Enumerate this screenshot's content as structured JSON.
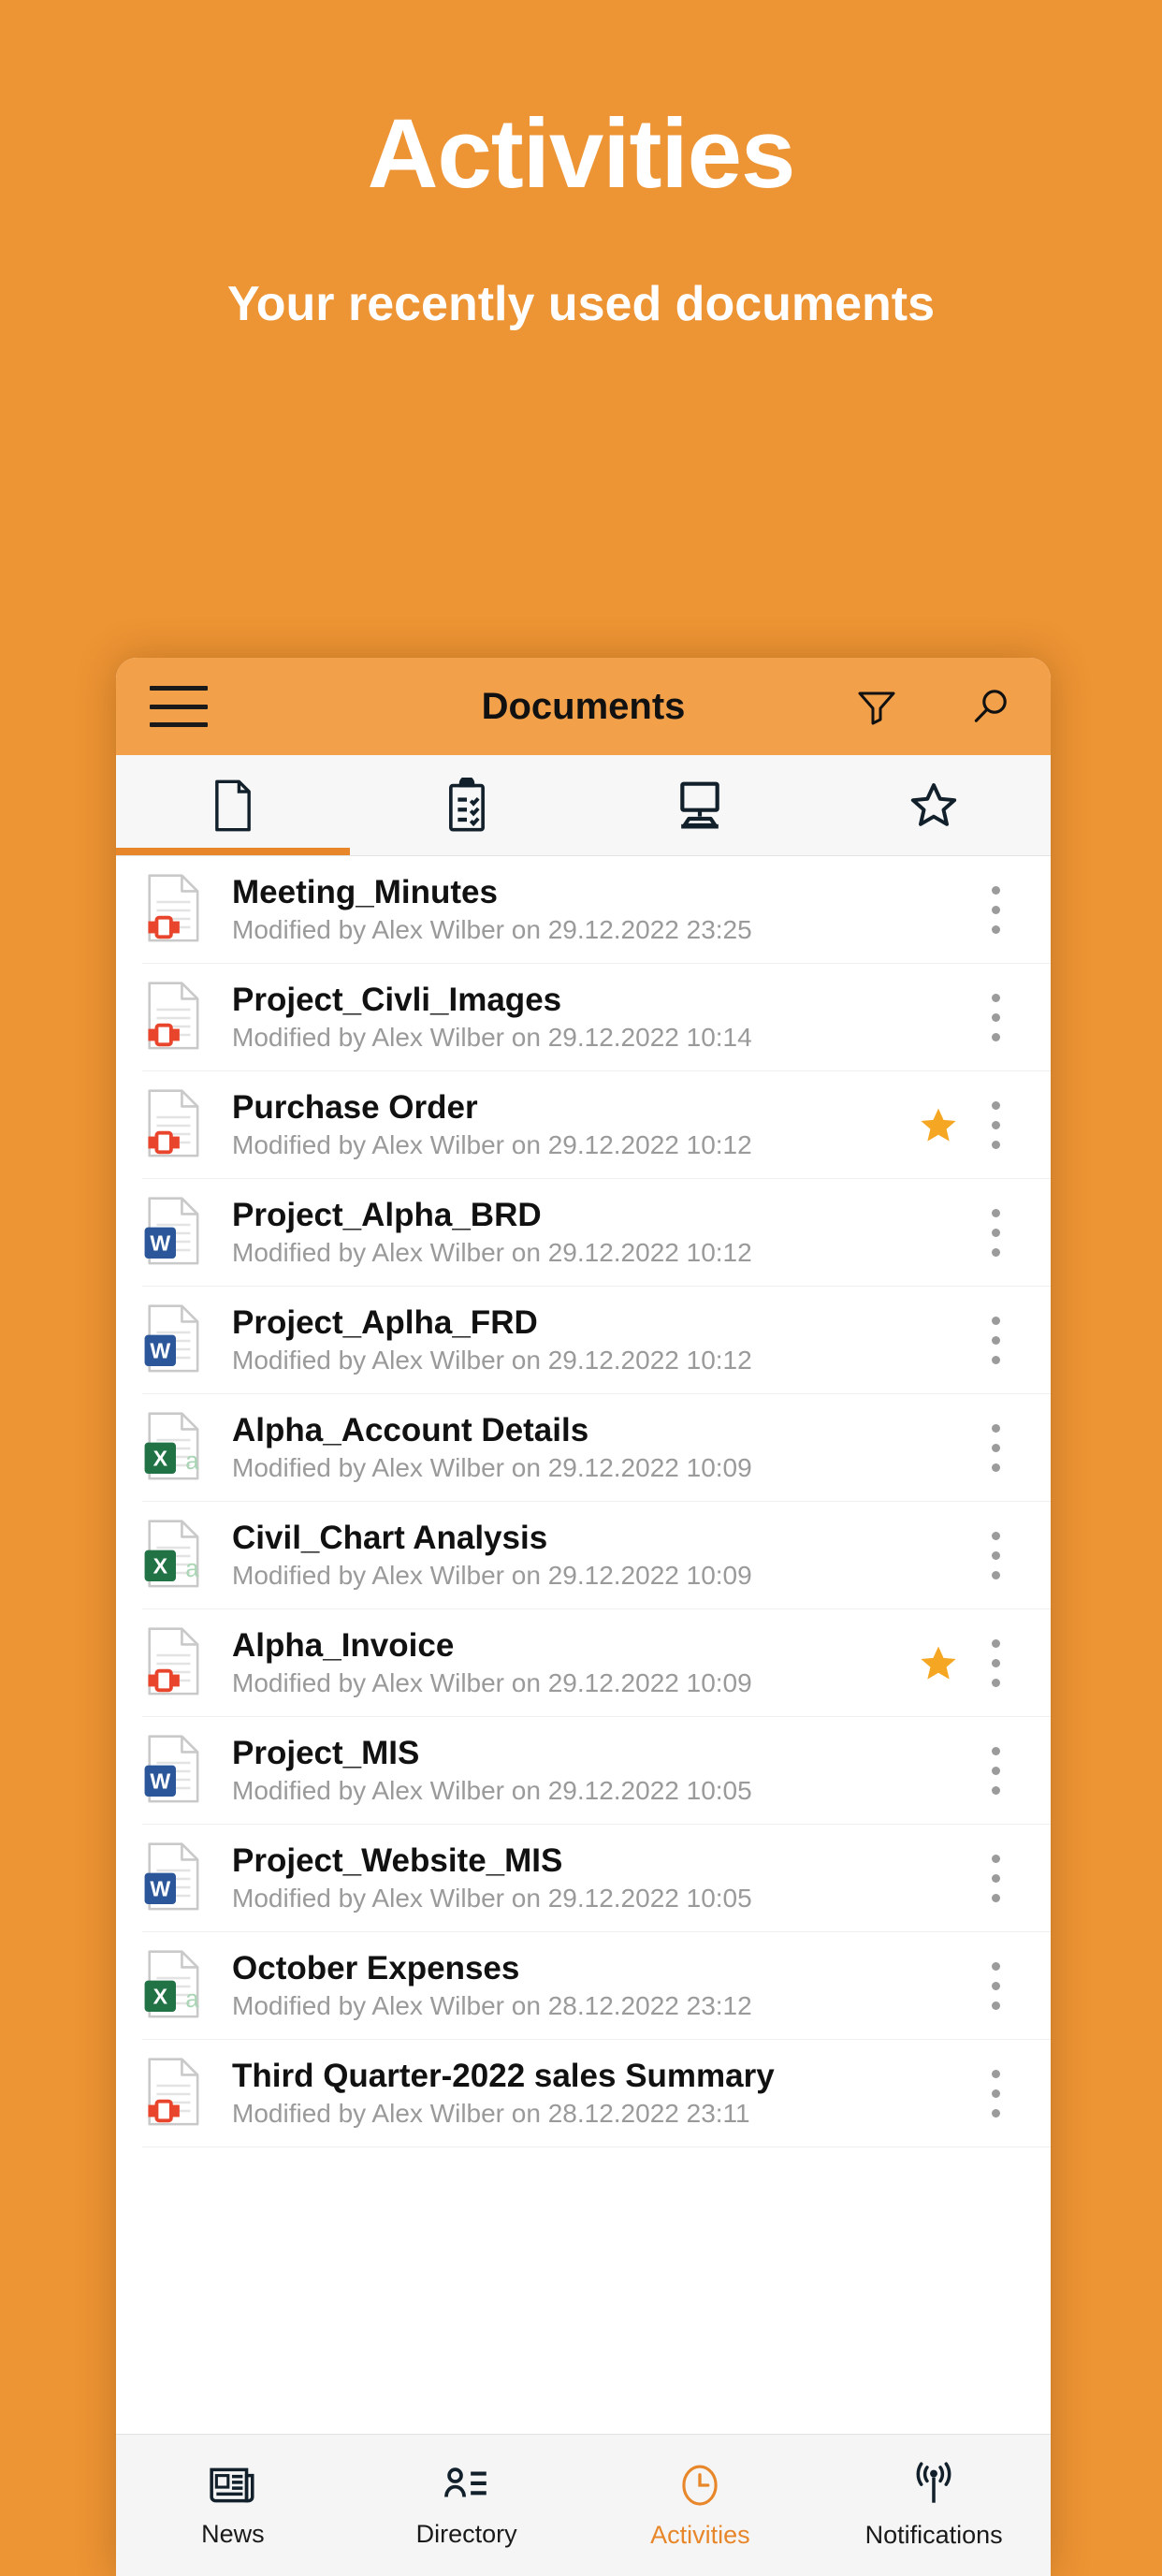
{
  "promo": {
    "title": "Activities",
    "subtitle": "Your recently used documents"
  },
  "colors": {
    "background": "#ED9434",
    "appbar": "#F2A14A",
    "accent": "#E8862A",
    "star": "#F5A623",
    "word": "#2B579A",
    "excel": "#217346",
    "pdf": "#E8452C"
  },
  "appbar": {
    "title": "Documents",
    "menu_icon": "hamburger-menu-icon",
    "filter_icon": "filter-funnel-icon",
    "search_icon": "search-magnifier-icon"
  },
  "tabs": [
    {
      "name": "documents",
      "icon": "document-page-icon",
      "active": true
    },
    {
      "name": "tasks",
      "icon": "clipboard-checklist-icon",
      "active": false
    },
    {
      "name": "sites",
      "icon": "desktop-monitor-icon",
      "active": false
    },
    {
      "name": "favorites",
      "icon": "star-outline-icon",
      "active": false
    }
  ],
  "documents": [
    {
      "name": "Meeting_Minutes",
      "meta": "Modified by Alex Wilber on 29.12.2022 23:25",
      "type": "pdf",
      "starred": false
    },
    {
      "name": "Project_Civli_Images",
      "meta": "Modified by Alex Wilber on 29.12.2022 10:14",
      "type": "pdf",
      "starred": false
    },
    {
      "name": "Purchase Order",
      "meta": "Modified by Alex Wilber on 29.12.2022 10:12",
      "type": "pdf",
      "starred": true
    },
    {
      "name": "Project_Alpha_BRD",
      "meta": "Modified by Alex Wilber on 29.12.2022 10:12",
      "type": "word",
      "starred": false
    },
    {
      "name": "Project_Aplha_FRD",
      "meta": "Modified by Alex Wilber on 29.12.2022 10:12",
      "type": "word",
      "starred": false
    },
    {
      "name": "Alpha_Account Details",
      "meta": "Modified by Alex Wilber on 29.12.2022 10:09",
      "type": "excel",
      "starred": false
    },
    {
      "name": "Civil_Chart Analysis",
      "meta": "Modified by Alex Wilber on 29.12.2022 10:09",
      "type": "excel",
      "starred": false
    },
    {
      "name": "Alpha_Invoice",
      "meta": "Modified by Alex Wilber on 29.12.2022 10:09",
      "type": "pdf",
      "starred": true
    },
    {
      "name": "Project_MIS",
      "meta": "Modified by Alex Wilber on 29.12.2022 10:05",
      "type": "word",
      "starred": false
    },
    {
      "name": "Project_Website_MIS",
      "meta": "Modified by Alex Wilber on 29.12.2022 10:05",
      "type": "word",
      "starred": false
    },
    {
      "name": "October Expenses",
      "meta": "Modified by Alex Wilber on 28.12.2022 23:12",
      "type": "excel",
      "starred": false
    },
    {
      "name": "Third Quarter-2022 sales Summary",
      "meta": "Modified by Alex Wilber on 28.12.2022 23:11",
      "type": "pdf",
      "starred": false
    }
  ],
  "bottom_nav": [
    {
      "label": "News",
      "icon": "newspaper-icon",
      "active": false
    },
    {
      "label": "Directory",
      "icon": "contacts-list-icon",
      "active": false
    },
    {
      "label": "Activities",
      "icon": "clock-icon",
      "active": true
    },
    {
      "label": "Notifications",
      "icon": "broadcast-icon",
      "active": false
    }
  ]
}
